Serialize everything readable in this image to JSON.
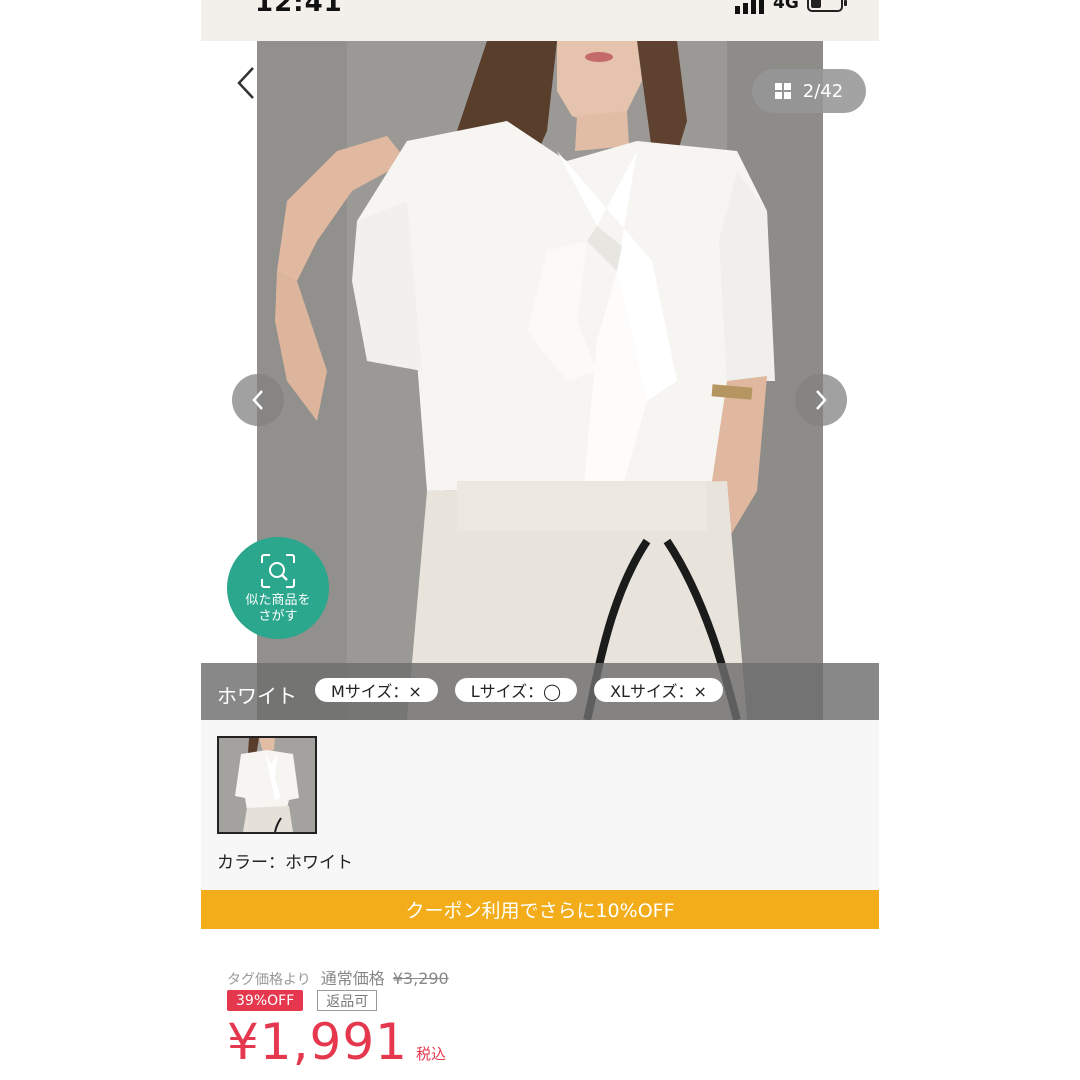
{
  "status_bar": {
    "time": "12:41",
    "network": "4G"
  },
  "gallery": {
    "counter": "2/42",
    "similar_button_line1": "似た商品を",
    "similar_button_line2": "さがす",
    "size_bar": {
      "color": "ホワイト",
      "sizes": [
        "Mサイズ：×",
        "Lサイズ：◯",
        "XLサイズ：×"
      ]
    }
  },
  "thumbnail": {
    "color_label": "カラー：ホワイト"
  },
  "coupon": {
    "text": "クーポン利用でさらに10%OFF"
  },
  "price": {
    "tag_label": "タグ価格より",
    "regular_label": "通常価格",
    "regular_price": "¥3,290",
    "discount_badge": "39%OFF",
    "return_badge": "返品可",
    "sale_price": "¥1,991",
    "tax_label": "税込"
  },
  "colors": {
    "accent_red": "#e5384f",
    "coupon_orange": "#f3ad1a",
    "similar_green": "#2aa78c"
  }
}
